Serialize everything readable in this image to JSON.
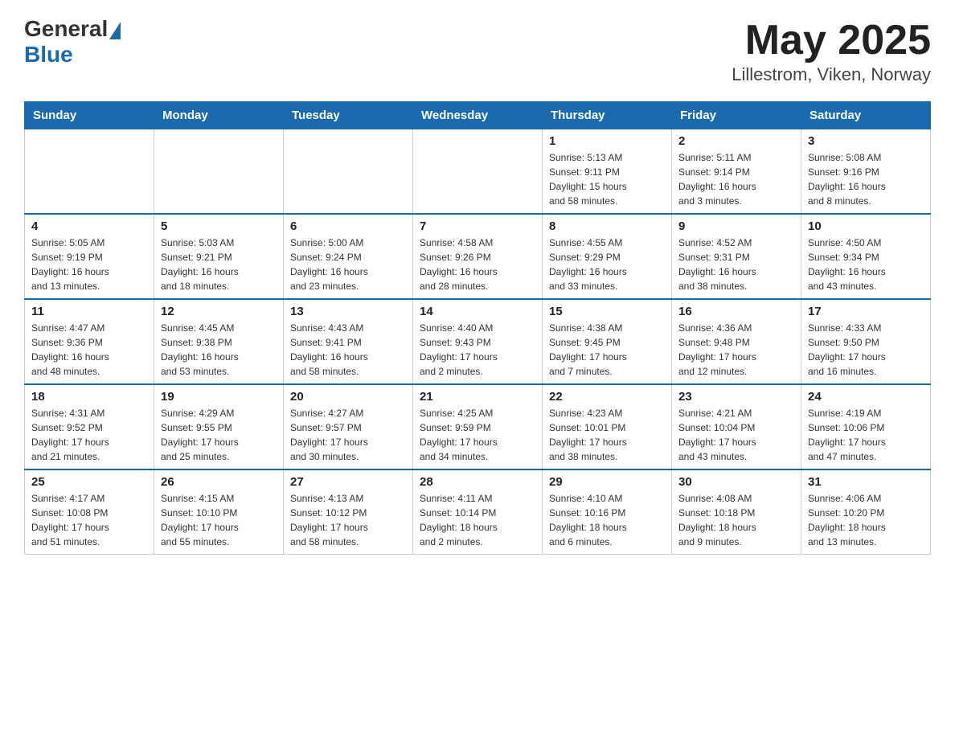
{
  "header": {
    "logo_general": "General",
    "logo_blue": "Blue",
    "title": "May 2025",
    "subtitle": "Lillestrom, Viken, Norway"
  },
  "weekdays": [
    "Sunday",
    "Monday",
    "Tuesday",
    "Wednesday",
    "Thursday",
    "Friday",
    "Saturday"
  ],
  "weeks": [
    [
      {
        "day": "",
        "info": ""
      },
      {
        "day": "",
        "info": ""
      },
      {
        "day": "",
        "info": ""
      },
      {
        "day": "",
        "info": ""
      },
      {
        "day": "1",
        "info": "Sunrise: 5:13 AM\nSunset: 9:11 PM\nDaylight: 15 hours\nand 58 minutes."
      },
      {
        "day": "2",
        "info": "Sunrise: 5:11 AM\nSunset: 9:14 PM\nDaylight: 16 hours\nand 3 minutes."
      },
      {
        "day": "3",
        "info": "Sunrise: 5:08 AM\nSunset: 9:16 PM\nDaylight: 16 hours\nand 8 minutes."
      }
    ],
    [
      {
        "day": "4",
        "info": "Sunrise: 5:05 AM\nSunset: 9:19 PM\nDaylight: 16 hours\nand 13 minutes."
      },
      {
        "day": "5",
        "info": "Sunrise: 5:03 AM\nSunset: 9:21 PM\nDaylight: 16 hours\nand 18 minutes."
      },
      {
        "day": "6",
        "info": "Sunrise: 5:00 AM\nSunset: 9:24 PM\nDaylight: 16 hours\nand 23 minutes."
      },
      {
        "day": "7",
        "info": "Sunrise: 4:58 AM\nSunset: 9:26 PM\nDaylight: 16 hours\nand 28 minutes."
      },
      {
        "day": "8",
        "info": "Sunrise: 4:55 AM\nSunset: 9:29 PM\nDaylight: 16 hours\nand 33 minutes."
      },
      {
        "day": "9",
        "info": "Sunrise: 4:52 AM\nSunset: 9:31 PM\nDaylight: 16 hours\nand 38 minutes."
      },
      {
        "day": "10",
        "info": "Sunrise: 4:50 AM\nSunset: 9:34 PM\nDaylight: 16 hours\nand 43 minutes."
      }
    ],
    [
      {
        "day": "11",
        "info": "Sunrise: 4:47 AM\nSunset: 9:36 PM\nDaylight: 16 hours\nand 48 minutes."
      },
      {
        "day": "12",
        "info": "Sunrise: 4:45 AM\nSunset: 9:38 PM\nDaylight: 16 hours\nand 53 minutes."
      },
      {
        "day": "13",
        "info": "Sunrise: 4:43 AM\nSunset: 9:41 PM\nDaylight: 16 hours\nand 58 minutes."
      },
      {
        "day": "14",
        "info": "Sunrise: 4:40 AM\nSunset: 9:43 PM\nDaylight: 17 hours\nand 2 minutes."
      },
      {
        "day": "15",
        "info": "Sunrise: 4:38 AM\nSunset: 9:45 PM\nDaylight: 17 hours\nand 7 minutes."
      },
      {
        "day": "16",
        "info": "Sunrise: 4:36 AM\nSunset: 9:48 PM\nDaylight: 17 hours\nand 12 minutes."
      },
      {
        "day": "17",
        "info": "Sunrise: 4:33 AM\nSunset: 9:50 PM\nDaylight: 17 hours\nand 16 minutes."
      }
    ],
    [
      {
        "day": "18",
        "info": "Sunrise: 4:31 AM\nSunset: 9:52 PM\nDaylight: 17 hours\nand 21 minutes."
      },
      {
        "day": "19",
        "info": "Sunrise: 4:29 AM\nSunset: 9:55 PM\nDaylight: 17 hours\nand 25 minutes."
      },
      {
        "day": "20",
        "info": "Sunrise: 4:27 AM\nSunset: 9:57 PM\nDaylight: 17 hours\nand 30 minutes."
      },
      {
        "day": "21",
        "info": "Sunrise: 4:25 AM\nSunset: 9:59 PM\nDaylight: 17 hours\nand 34 minutes."
      },
      {
        "day": "22",
        "info": "Sunrise: 4:23 AM\nSunset: 10:01 PM\nDaylight: 17 hours\nand 38 minutes."
      },
      {
        "day": "23",
        "info": "Sunrise: 4:21 AM\nSunset: 10:04 PM\nDaylight: 17 hours\nand 43 minutes."
      },
      {
        "day": "24",
        "info": "Sunrise: 4:19 AM\nSunset: 10:06 PM\nDaylight: 17 hours\nand 47 minutes."
      }
    ],
    [
      {
        "day": "25",
        "info": "Sunrise: 4:17 AM\nSunset: 10:08 PM\nDaylight: 17 hours\nand 51 minutes."
      },
      {
        "day": "26",
        "info": "Sunrise: 4:15 AM\nSunset: 10:10 PM\nDaylight: 17 hours\nand 55 minutes."
      },
      {
        "day": "27",
        "info": "Sunrise: 4:13 AM\nSunset: 10:12 PM\nDaylight: 17 hours\nand 58 minutes."
      },
      {
        "day": "28",
        "info": "Sunrise: 4:11 AM\nSunset: 10:14 PM\nDaylight: 18 hours\nand 2 minutes."
      },
      {
        "day": "29",
        "info": "Sunrise: 4:10 AM\nSunset: 10:16 PM\nDaylight: 18 hours\nand 6 minutes."
      },
      {
        "day": "30",
        "info": "Sunrise: 4:08 AM\nSunset: 10:18 PM\nDaylight: 18 hours\nand 9 minutes."
      },
      {
        "day": "31",
        "info": "Sunrise: 4:06 AM\nSunset: 10:20 PM\nDaylight: 18 hours\nand 13 minutes."
      }
    ]
  ]
}
